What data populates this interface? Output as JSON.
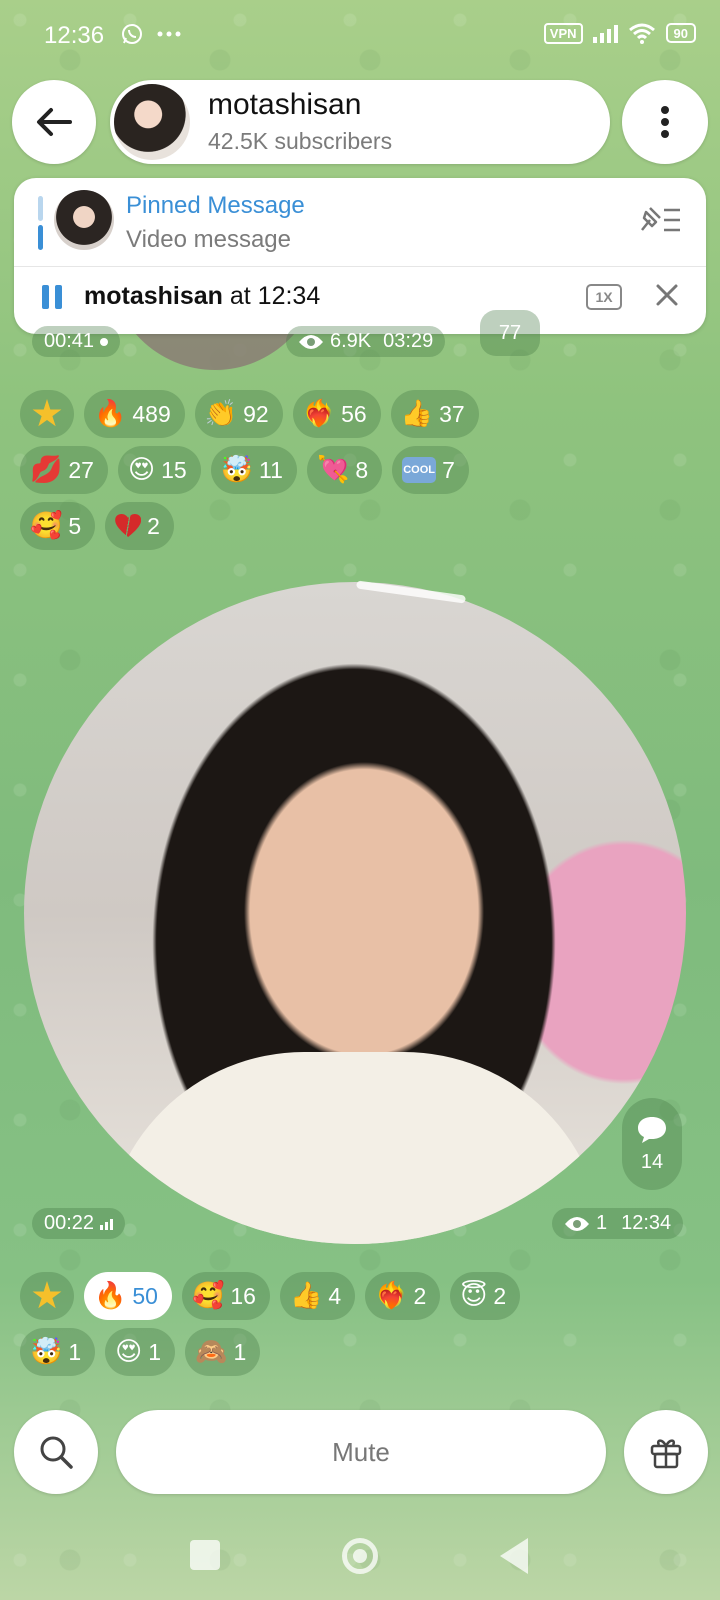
{
  "status_bar": {
    "time": "12:36",
    "left_icons": [
      "whatsapp-icon",
      "more-dots-icon"
    ],
    "vpn": "VPN",
    "battery": "90"
  },
  "header": {
    "channel_name": "motashisan",
    "subscribers": "42.5K subscribers"
  },
  "pinned": {
    "title": "Pinned Message",
    "subtitle": "Video message"
  },
  "player": {
    "author": "motashisan",
    "at_time": " at 12:34",
    "speed": "1X"
  },
  "previous_message": {
    "duration": "00:41",
    "views": "6.9K",
    "time": "03:29",
    "comments": "77",
    "reactions": [
      {
        "emoji": "star-icon",
        "count": ""
      },
      {
        "emoji": "🔥",
        "count": "489"
      },
      {
        "emoji": "👏",
        "count": "92"
      },
      {
        "emoji": "❤️‍🔥",
        "count": "56"
      },
      {
        "emoji": "👍",
        "count": "37"
      },
      {
        "emoji": "💋",
        "count": "27"
      },
      {
        "emoji": "😍",
        "count": "15"
      },
      {
        "emoji": "🤯",
        "count": "11"
      },
      {
        "emoji": "💘",
        "count": "8"
      },
      {
        "emoji": "COOL",
        "count": "7"
      },
      {
        "emoji": "🥰",
        "count": "5"
      },
      {
        "emoji": "💔",
        "count": "2"
      }
    ]
  },
  "video_message": {
    "duration": "00:22",
    "comments": "14",
    "views": "1",
    "time": "12:34",
    "reactions": [
      {
        "emoji": "star-icon",
        "count": ""
      },
      {
        "emoji": "🔥",
        "count": "50",
        "active": true
      },
      {
        "emoji": "🥰",
        "count": "16"
      },
      {
        "emoji": "👍",
        "count": "4"
      },
      {
        "emoji": "❤️‍🔥",
        "count": "2"
      },
      {
        "emoji": "😇",
        "count": "2"
      },
      {
        "emoji": "🤯",
        "count": "1"
      },
      {
        "emoji": "😍",
        "count": "1"
      },
      {
        "emoji": "🙈",
        "count": "1"
      }
    ]
  },
  "bottom_bar": {
    "mute_label": "Mute"
  },
  "colors": {
    "accent": "#3a8fd6",
    "chip_bg": "rgba(70,120,70,0.35)"
  }
}
